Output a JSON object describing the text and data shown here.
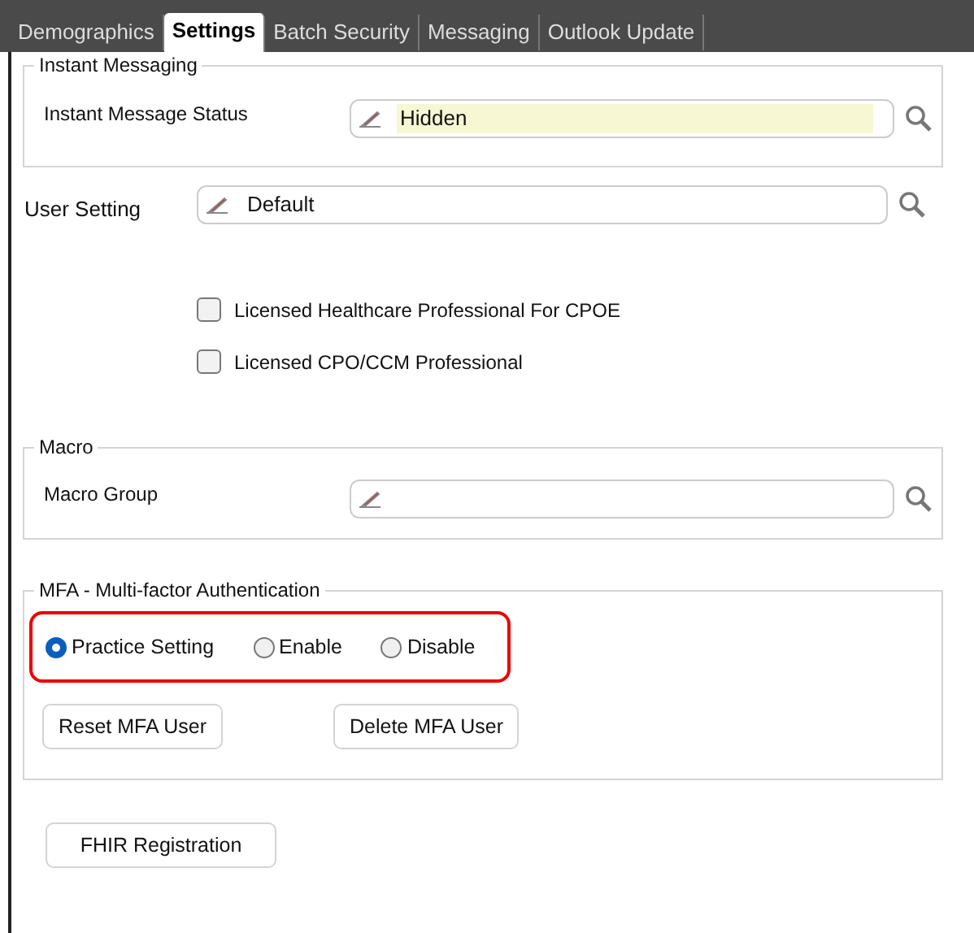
{
  "tabs": [
    {
      "label": "Demographics",
      "selected": false
    },
    {
      "label": "Settings",
      "selected": true
    },
    {
      "label": "Batch Security",
      "selected": false
    },
    {
      "label": "Messaging",
      "selected": false
    },
    {
      "label": "Outlook Update",
      "selected": false
    }
  ],
  "instant_messaging": {
    "title": "Instant Messaging",
    "field": {
      "label": "Instant Message Status",
      "value": "Hidden",
      "highlighted": true
    }
  },
  "user_setting": {
    "label": "User Setting",
    "value": "Default",
    "highlighted": false
  },
  "checkboxes": [
    {
      "label": "Licensed Healthcare Professional For CPOE",
      "checked": false
    },
    {
      "label": "Licensed CPO/CCM Professional",
      "checked": false
    }
  ],
  "macro": {
    "title": "Macro",
    "field": {
      "label": "Macro Group",
      "highlighted": false
    }
  },
  "mfa": {
    "title": "MFA - Multi-factor Authentication",
    "options": [
      {
        "label": "Practice Setting",
        "selected": true
      },
      {
        "label": "Enable",
        "selected": false
      },
      {
        "label": "Disable",
        "selected": false
      }
    ],
    "buttons": [
      "Reset MFA User",
      "Delete MFA User"
    ]
  },
  "buttons": [
    "FHIR Registration"
  ]
}
